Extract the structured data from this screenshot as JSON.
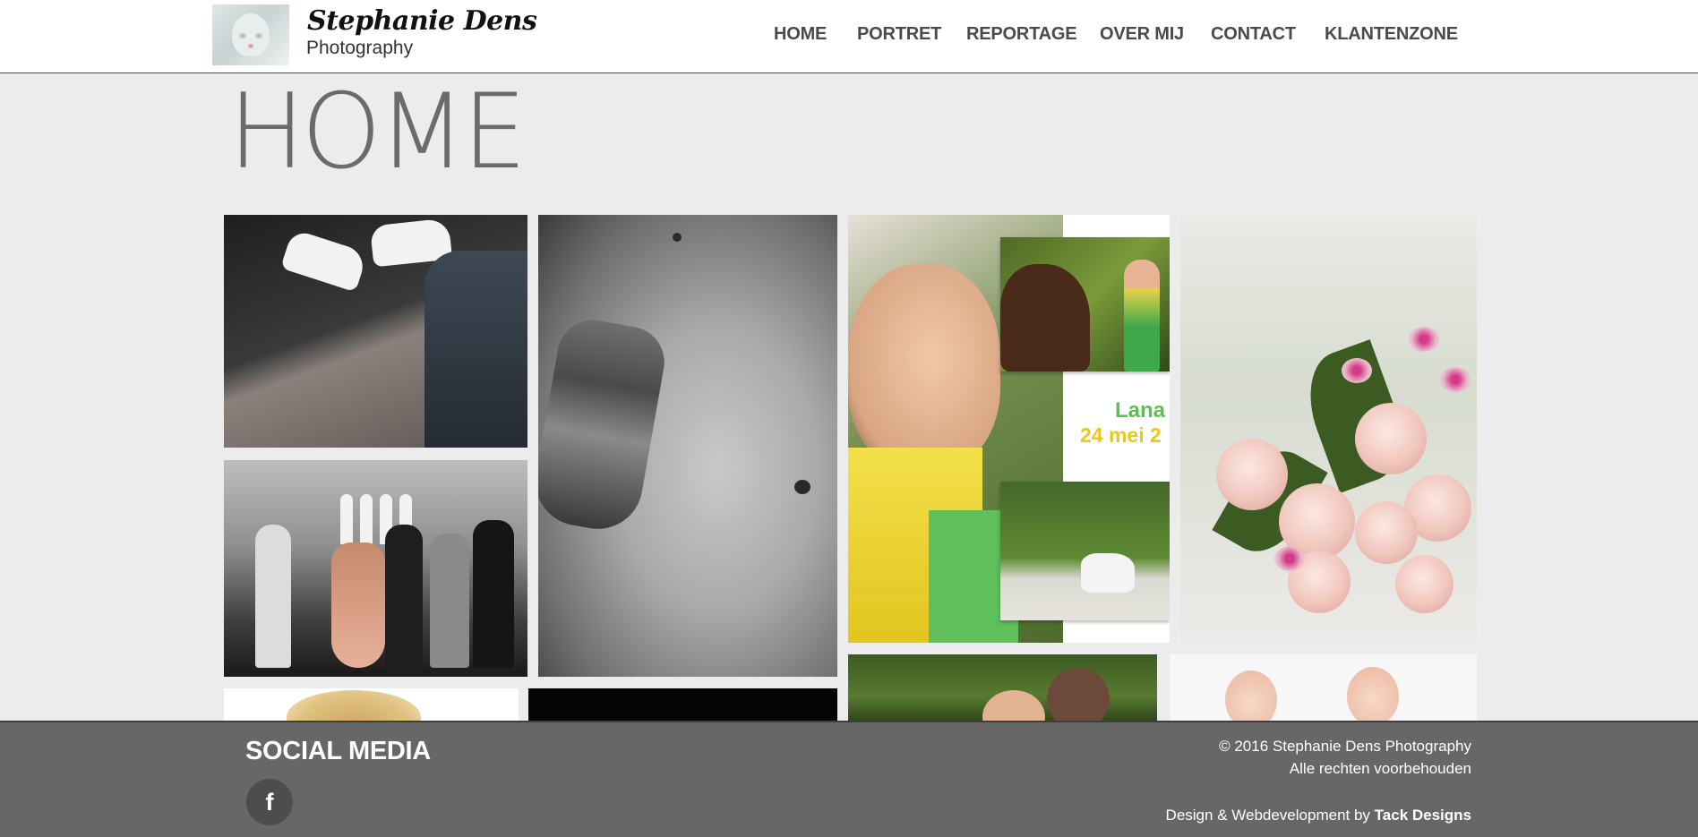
{
  "header": {
    "brand_title": "Stephanie Dens",
    "brand_subtitle": "Photography",
    "nav": [
      "HOME",
      "PORTRET",
      "REPORTAGE",
      "OVER MIJ",
      "CONTACT",
      "KLANTENZONE"
    ]
  },
  "main": {
    "page_title": "HOME",
    "tile_text": {
      "name": "Lana",
      "date": "24 mei 2"
    }
  },
  "footer": {
    "social_title": "SOCIAL MEDIA",
    "social_icon": "facebook-icon",
    "social_glyph": "f",
    "copyright": "© 2016 Stephanie Dens Photography",
    "rights": "Alle rechten voorbehouden",
    "credit_prefix": "Design & Webdevelopment by",
    "credit_name": "Tack Designs"
  },
  "colors": {
    "header_bg": "#ffffff",
    "page_bg": "#ececec",
    "nav_text": "#4a4a4a",
    "title_text": "#6b6b6b",
    "footer_bg": "#676767"
  }
}
